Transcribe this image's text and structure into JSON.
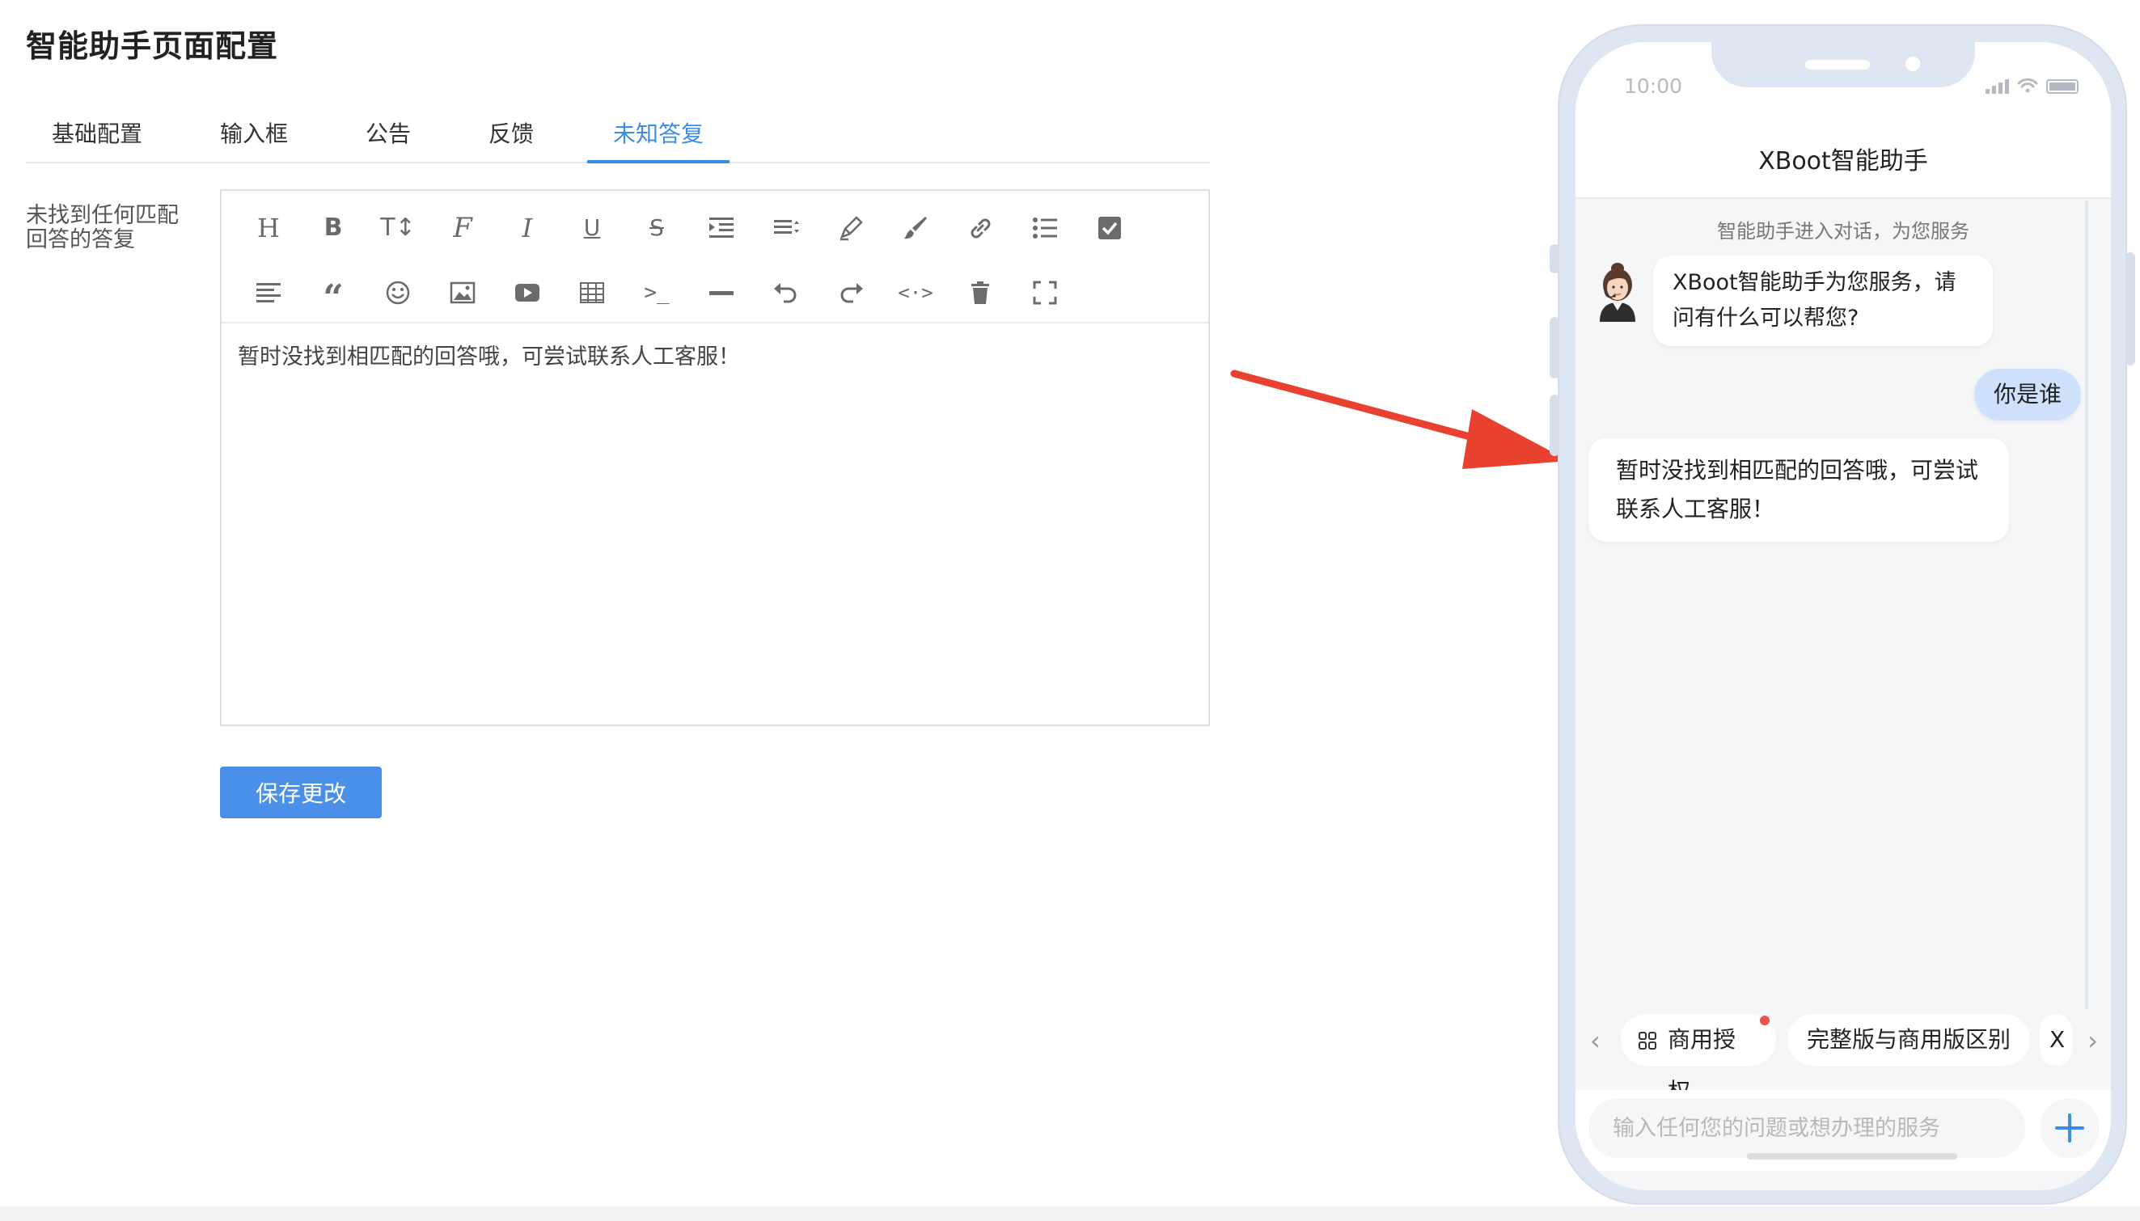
{
  "page": {
    "title": "智能助手页面配置"
  },
  "tabs": [
    {
      "label": "基础配置"
    },
    {
      "label": "输入框"
    },
    {
      "label": "公告"
    },
    {
      "label": "反馈"
    },
    {
      "label": "未知答复",
      "active": true
    }
  ],
  "form": {
    "field_label": "未找到任何匹配回答的答复",
    "editor_content": "暂时没找到相匹配的回答哦，可尝试联系人工客服！",
    "save_label": "保存更改",
    "toolbar_row1": [
      "heading-icon",
      "bold-icon",
      "font-size-icon",
      "font-family-icon",
      "italic-icon",
      "underline-icon",
      "strikethrough-icon",
      "indent-icon",
      "line-height-icon",
      "font-color-icon",
      "background-color-icon",
      "link-icon",
      "bullet-list-icon",
      "todo-checkbox-icon"
    ],
    "toolbar_row2": [
      "align-icon",
      "quote-icon",
      "emoji-icon",
      "image-icon",
      "video-icon",
      "table-icon",
      "code-icon",
      "divider-icon",
      "undo-icon",
      "redo-icon",
      "html-source-icon",
      "clear-icon",
      "fullscreen-icon"
    ]
  },
  "phone": {
    "status_time": "10:00",
    "chat_title": "XBoot智能助手",
    "notice": "智能助手进入对话，为您服务",
    "messages": [
      {
        "from": "bot",
        "text": "XBoot智能助手为您服务，请问有什么可以帮您?"
      },
      {
        "from": "user",
        "text": "你是谁"
      },
      {
        "from": "bot",
        "text": "暂时没找到相匹配的回答哦，可尝试联系人工客服！"
      }
    ],
    "quick_actions": [
      {
        "label": "商用授权",
        "icon": "grid-icon",
        "badge": true
      },
      {
        "label": "完整版与商用版区别"
      },
      {
        "label": "X"
      }
    ],
    "input_placeholder": "输入任何您的问题或想办理的服务"
  },
  "colors": {
    "accent": "#3c8ce7",
    "button": "#4a90e8",
    "user_bubble": "#cfe0fb",
    "arrow": "#e8412f",
    "badge": "#e9534b"
  }
}
